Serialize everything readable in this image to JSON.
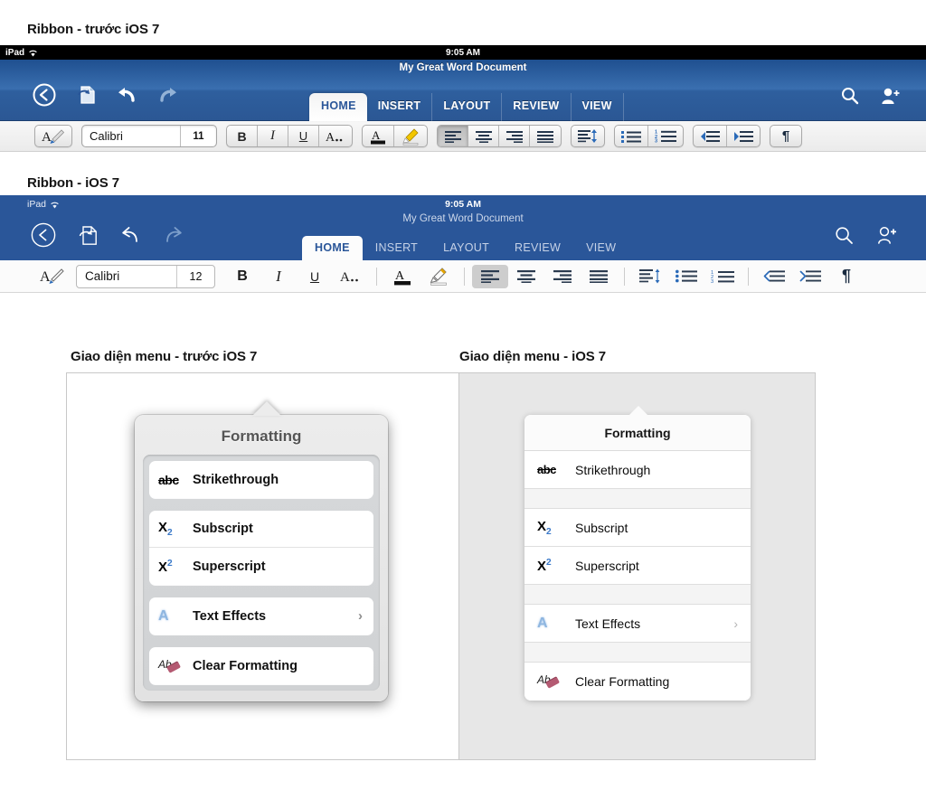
{
  "captions": {
    "ribbon_old": "Ribbon - trước iOS 7",
    "ribbon_new": "Ribbon - iOS 7",
    "menu_old": "Giao diện menu - trước iOS 7",
    "menu_new": "Giao diện menu - iOS 7"
  },
  "ribbon_old": {
    "status_bar": {
      "device": "iPad",
      "wifi_icon": "wifi-icon",
      "time": "9:05 AM"
    },
    "document_title": "My Great Word Document",
    "nav_icons": [
      "back-icon",
      "share-icon",
      "undo-icon",
      "redo-icon"
    ],
    "tabs": [
      {
        "label": "HOME",
        "active": true
      },
      {
        "label": "INSERT",
        "active": false
      },
      {
        "label": "LAYOUT",
        "active": false
      },
      {
        "label": "REVIEW",
        "active": false
      },
      {
        "label": "VIEW",
        "active": false
      }
    ],
    "nav_right_icons": [
      "search-icon",
      "add-person-icon"
    ],
    "font_name": "Calibri",
    "font_size": "11",
    "toolbar_buttons": [
      {
        "name": "format-painter",
        "label": "A",
        "icon": "format-painter-icon"
      },
      {
        "name": "bold",
        "label": "B"
      },
      {
        "name": "italic",
        "label": "I"
      },
      {
        "name": "underline",
        "label": "U"
      },
      {
        "name": "more-font-options",
        "label": "A.."
      },
      {
        "name": "font-color",
        "label": "A",
        "icon": "font-color-icon"
      },
      {
        "name": "highlight",
        "label": "",
        "icon": "highlighter-icon"
      },
      {
        "name": "align-left",
        "icon": "align-left-icon",
        "active": true
      },
      {
        "name": "align-center",
        "icon": "align-center-icon"
      },
      {
        "name": "align-right",
        "icon": "align-right-icon"
      },
      {
        "name": "align-justify",
        "icon": "align-justify-icon"
      },
      {
        "name": "line-spacing",
        "icon": "line-spacing-icon"
      },
      {
        "name": "bulleted-list",
        "icon": "bulleted-list-icon"
      },
      {
        "name": "numbered-list",
        "icon": "numbered-list-icon"
      },
      {
        "name": "decrease-indent",
        "icon": "decrease-indent-icon"
      },
      {
        "name": "increase-indent",
        "icon": "increase-indent-icon"
      },
      {
        "name": "show-formatting-marks",
        "icon": "pilcrow-icon"
      }
    ]
  },
  "ribbon_new": {
    "status_bar": {
      "device": "iPad",
      "wifi_icon": "wifi-icon",
      "time": "9:05 AM"
    },
    "document_title": "My Great Word Document",
    "nav_icons": [
      "back-icon",
      "share-icon",
      "undo-icon",
      "redo-icon"
    ],
    "tabs": [
      {
        "label": "HOME",
        "active": true
      },
      {
        "label": "INSERT",
        "active": false
      },
      {
        "label": "LAYOUT",
        "active": false
      },
      {
        "label": "REVIEW",
        "active": false
      },
      {
        "label": "VIEW",
        "active": false
      }
    ],
    "nav_right_icons": [
      "search-icon",
      "add-person-icon"
    ],
    "font_name": "Calibri",
    "font_size": "12",
    "toolbar_buttons": [
      {
        "name": "format-painter",
        "label": "A",
        "icon": "format-painter-icon"
      },
      {
        "name": "bold",
        "label": "B"
      },
      {
        "name": "italic",
        "label": "I"
      },
      {
        "name": "underline",
        "label": "U"
      },
      {
        "name": "more-font-options",
        "label": "A.."
      },
      {
        "name": "font-color",
        "label": "A",
        "icon": "font-color-icon"
      },
      {
        "name": "highlight",
        "label": "",
        "icon": "highlighter-icon"
      },
      {
        "name": "align-left",
        "icon": "align-left-icon",
        "active": true
      },
      {
        "name": "align-center",
        "icon": "align-center-icon"
      },
      {
        "name": "align-right",
        "icon": "align-right-icon"
      },
      {
        "name": "align-justify",
        "icon": "align-justify-icon"
      },
      {
        "name": "line-spacing",
        "icon": "line-spacing-icon"
      },
      {
        "name": "bulleted-list",
        "icon": "bulleted-list-icon"
      },
      {
        "name": "numbered-list",
        "icon": "numbered-list-icon"
      },
      {
        "name": "decrease-indent",
        "icon": "decrease-indent-icon"
      },
      {
        "name": "increase-indent",
        "icon": "increase-indent-icon"
      },
      {
        "name": "show-formatting-marks",
        "icon": "pilcrow-icon"
      }
    ]
  },
  "menu_popover": {
    "title": "Formatting",
    "items": [
      {
        "label": "Strikethrough",
        "icon": "strikethrough-icon",
        "chevron": false
      },
      {
        "label": "Subscript",
        "icon": "subscript-icon",
        "chevron": false
      },
      {
        "label": "Superscript",
        "icon": "superscript-icon",
        "chevron": false
      },
      {
        "label": "Text Effects",
        "icon": "text-effects-icon",
        "chevron": true
      },
      {
        "label": "Clear Formatting",
        "icon": "clear-formatting-icon",
        "chevron": false
      }
    ],
    "chevron_glyph": "›"
  },
  "colors": {
    "navbar_old_top": "#1f4f8f",
    "navbar_old_bottom": "#2b5794",
    "navbar_new": "#2a5699",
    "accent_blue": "#3a79c9",
    "panel_old_bg": "#ffffff",
    "panel_new_bg": "#e7e7e7"
  }
}
